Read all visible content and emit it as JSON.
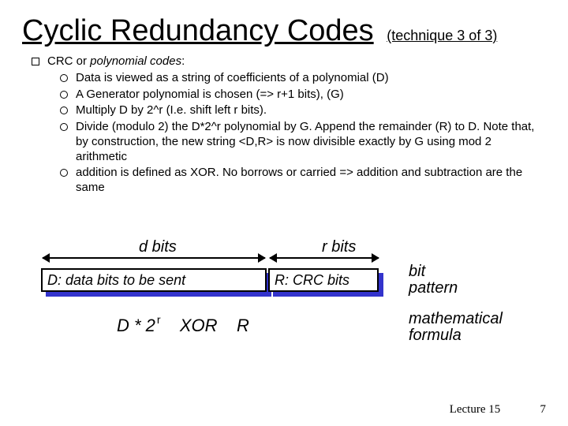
{
  "title": {
    "main": "Cyclic Redundancy Codes",
    "paren": "(technique 3 of 3)"
  },
  "list": {
    "heading_prefix": "CRC or ",
    "heading_em": "polynomial codes",
    "heading_suffix": ":",
    "items": [
      "Data is viewed as a string of coefficients of a polynomial (D)",
      "A Generator polynomial is chosen (=> r+1 bits), (G)",
      "Multiply D by 2^r (I.e. shift left r bits).",
      "Divide (modulo 2) the D*2^r polynomial by G. Append the remainder (R) to D. Note that, by construction, the new string  <D,R>  is now divisible exactly by G using mod 2 arithmetic",
      "addition is defined as XOR. No borrows or carried => addition and subtraction are the same"
    ]
  },
  "diagram": {
    "dbits": "d bits",
    "rbits": "r bits",
    "box_d": "D: data bits to be sent",
    "box_r": "R: CRC bits",
    "bit_pattern_l1": "bit",
    "bit_pattern_l2": "pattern",
    "formula_d": "D * 2",
    "formula_exp": "r",
    "formula_xor": "XOR",
    "formula_r": "R",
    "math_l1": "mathematical",
    "math_l2": "formula"
  },
  "footer": {
    "lecture": "Lecture 15",
    "page": "7"
  }
}
